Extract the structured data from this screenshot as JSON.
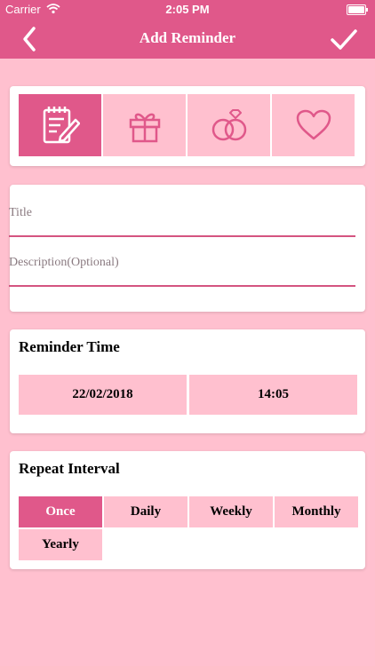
{
  "status": {
    "carrier": "Carrier",
    "time": "2:05 PM"
  },
  "nav": {
    "title": "Add Reminder"
  },
  "categories": [
    {
      "icon": "notepad-icon",
      "selected": true
    },
    {
      "icon": "gift-icon",
      "selected": false
    },
    {
      "icon": "rings-icon",
      "selected": false
    },
    {
      "icon": "heart-icon",
      "selected": false
    }
  ],
  "form": {
    "title_placeholder": "Title",
    "description_placeholder": "Description(Optional)"
  },
  "reminder_time": {
    "heading": "Reminder Time",
    "date": "22/02/2018",
    "time": "14:05"
  },
  "repeat": {
    "heading": "Repeat Interval",
    "options": [
      "Once",
      "Daily",
      "Weekly",
      "Monthly",
      "Yearly"
    ],
    "selected": "Once"
  },
  "colors": {
    "accent": "#e0588a",
    "tile": "#ffc0cf",
    "background": "#ffc0cf"
  }
}
